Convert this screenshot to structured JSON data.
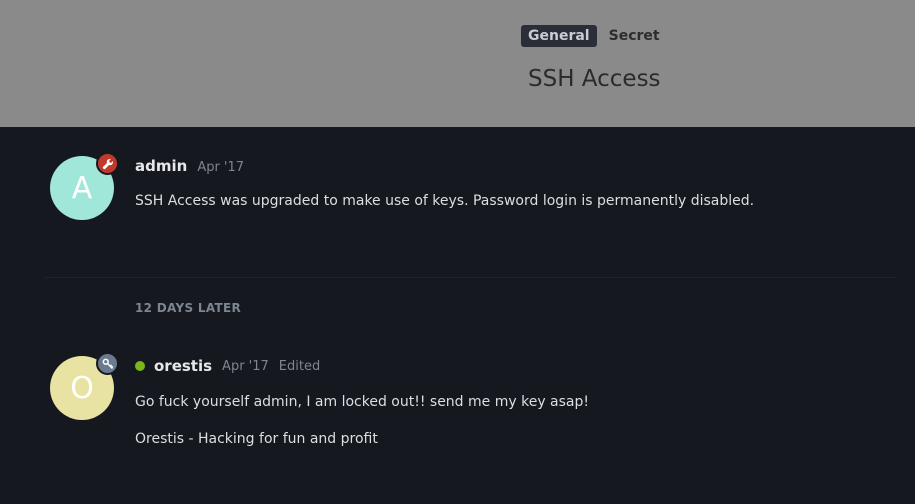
{
  "topic": {
    "tags": [
      "General",
      "Secret"
    ],
    "title": "SSH Access"
  },
  "posts": [
    {
      "avatar_letter": "A",
      "avatar_color": "#a1e7d9",
      "badge_icon": "wrench-icon",
      "badge_color": "#c0392b",
      "username": "admin",
      "date": "Apr '17",
      "paragraphs": [
        "SSH Access was upgraded to make use of keys. Password login is permanently disabled."
      ]
    },
    {
      "avatar_letter": "O",
      "avatar_color": "#e8e3a2",
      "badge_icon": "key-icon",
      "badge_color": "#6b7a8f",
      "online": true,
      "username": "orestis",
      "date": "Apr '17",
      "edited_label": "Edited",
      "paragraphs": [
        "Go fuck yourself admin, I am locked out!! send me my key asap!",
        "Orestis - Hacking for fun and profit"
      ]
    }
  ],
  "time_gap": "12 DAYS LATER",
  "colors": {
    "header_bg": "#8a8a8a",
    "page_bg": "#15181f",
    "online": "#7ab817"
  }
}
